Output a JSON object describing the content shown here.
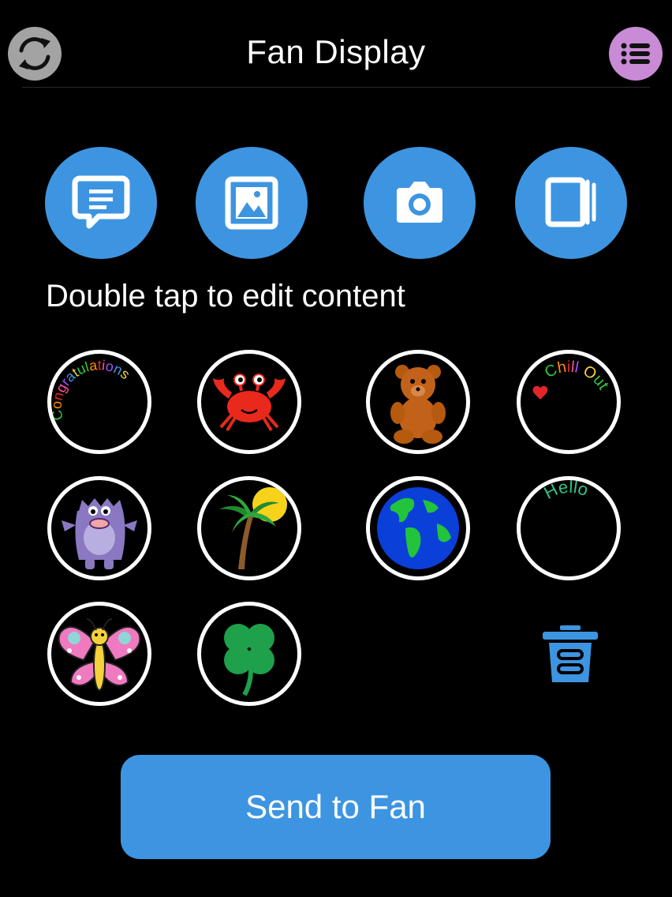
{
  "header": {
    "title": "Fan Display",
    "sync_icon": "sync-icon",
    "menu_icon": "list-menu-icon"
  },
  "actions": [
    {
      "icon": "message-icon"
    },
    {
      "icon": "image-icon"
    },
    {
      "icon": "camera-icon"
    },
    {
      "icon": "library-icon"
    }
  ],
  "hint": "Double tap to edit content",
  "slots": [
    {
      "name": "congratulations",
      "text": "Congratulations"
    },
    {
      "name": "crab"
    },
    {
      "name": "teddy-bear"
    },
    {
      "name": "chill-out",
      "text": "Chill Out"
    },
    {
      "name": "monster"
    },
    {
      "name": "palm-tree"
    },
    {
      "name": "earth"
    },
    {
      "name": "hello",
      "text": "Hello"
    },
    {
      "name": "butterfly"
    },
    {
      "name": "clover"
    }
  ],
  "trash_icon": "trash-icon",
  "send_button": "Send to Fan",
  "colors": {
    "background": "#000000",
    "accent_blue": "#3d95e1",
    "menu_purple": "#c98ad6",
    "sync_gray": "#a3a3a3"
  }
}
